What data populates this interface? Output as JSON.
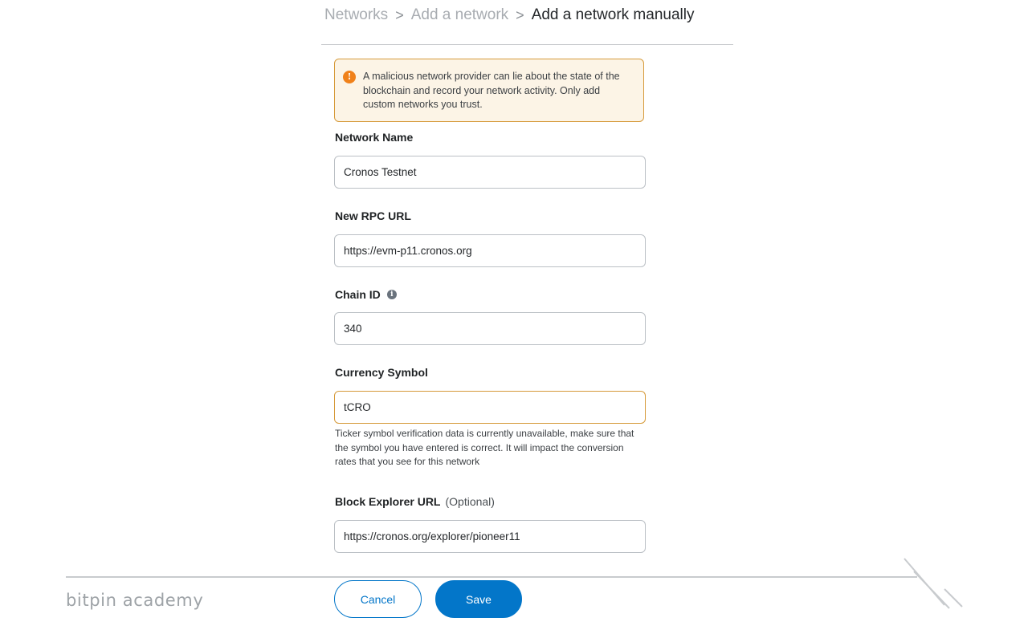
{
  "breadcrumb": {
    "items": [
      "Networks",
      "Add a network",
      "Add a network manually"
    ],
    "separator": ">"
  },
  "warning": {
    "icon": "exclamation-icon",
    "text": "A malicious network provider can lie about the state of the blockchain and record your network activity. Only add custom networks you trust."
  },
  "fields": {
    "network_name": {
      "label": "Network Name",
      "value": "Cronos Testnet"
    },
    "rpc_url": {
      "label": "New RPC URL",
      "value": "https://evm-p11.cronos.org"
    },
    "chain_id": {
      "label": "Chain ID",
      "value": "340",
      "info_icon": "info-icon"
    },
    "currency_symbol": {
      "label": "Currency Symbol",
      "value": "tCRO",
      "helper": "Ticker symbol verification data is currently unavailable, make sure that the symbol you have entered is correct. It will impact the conversion rates that you see for this network"
    },
    "block_explorer": {
      "label": "Block Explorer URL",
      "optional": "(Optional)",
      "value": "https://cronos.org/explorer/pioneer11"
    }
  },
  "buttons": {
    "cancel": "Cancel",
    "save": "Save"
  },
  "watermark": {
    "text": "bitpin academy"
  },
  "colors": {
    "primary": "#0376c9",
    "warning_border": "#d69a3a",
    "warning_bg": "#fcf4e6",
    "warning_icon": "#f0811a"
  }
}
